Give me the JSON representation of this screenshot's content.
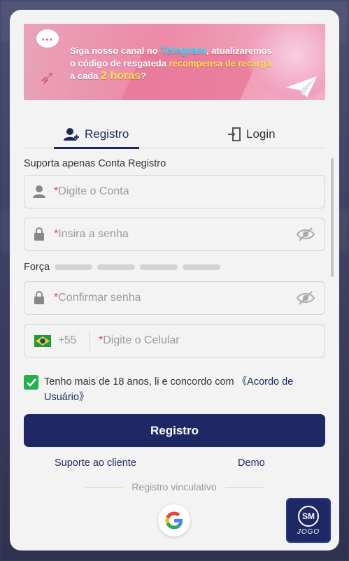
{
  "banner": {
    "line1_pre": "Siga nosso canal no ",
    "line1_tg": "Telegram",
    "line1_post": ", atualizaremos",
    "line2_pre": "o código de resgateda ",
    "line2_rc": "recompensa de recarga",
    "line3_pre": "a cada ",
    "line3_hrs": "2 horas",
    "line3_post": "?"
  },
  "tabs": {
    "register_label": "Registro",
    "login_label": "Login"
  },
  "form": {
    "account_type_label": "Suporta apenas Conta Registro",
    "required_mark": "*",
    "account_placeholder": "Digite o Conta",
    "password_placeholder": "Insira a senha",
    "strength_label": "Força",
    "confirm_placeholder": "Confirmar senha",
    "country_code": "+55",
    "phone_placeholder": "Digite o Celular",
    "agree_text": "Tenho mais de 18 anos, li e concordo com ",
    "agree_link": "《Acordo de Usuário》",
    "submit_label": "Registro"
  },
  "footer": {
    "support_link": "Suporte ao cliente",
    "demo_link": "Demo",
    "divider_text": "Registro vinculativo",
    "jogo_badge": "SM",
    "jogo_word": "JOGO"
  },
  "colors": {
    "primary": "#1e2865",
    "checkbox": "#22b14c",
    "required": "#e0454a",
    "telegram": "#37d6f0",
    "highlight": "#ffe24a"
  },
  "icons": [
    "user-plus-icon",
    "login-door-icon",
    "user-icon",
    "lock-icon",
    "eye-slash-icon",
    "brazil-flag-icon",
    "check-icon",
    "google-icon",
    "jogo-logo-icon",
    "chat-bubble-icon",
    "paper-plane-icon"
  ]
}
